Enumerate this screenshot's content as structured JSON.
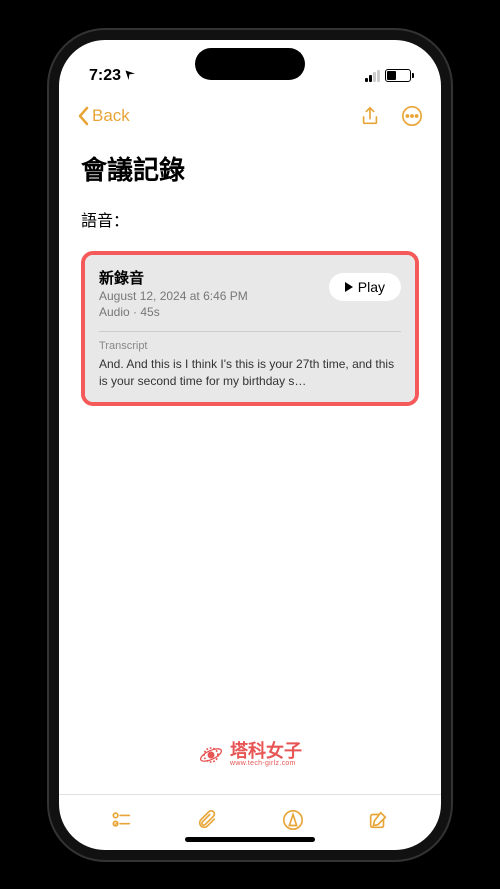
{
  "status": {
    "time": "7:23",
    "location_icon": "◀"
  },
  "nav": {
    "back_label": "Back"
  },
  "note": {
    "title": "會議記錄",
    "body": "語音："
  },
  "audio": {
    "title": "新錄音",
    "timestamp": "August 12, 2024 at 6:46 PM",
    "meta": "Audio · 45s",
    "play_label": "Play",
    "transcript_label": "Transcript",
    "transcript_text": "And. And this is I think I's this is your 27th time, and this is your second time for my birthday s…"
  },
  "watermark": {
    "title": "塔科女子",
    "url": "www.tech-girlz.com"
  },
  "colors": {
    "accent": "#e8a537",
    "highlight": "#f55a5a"
  }
}
